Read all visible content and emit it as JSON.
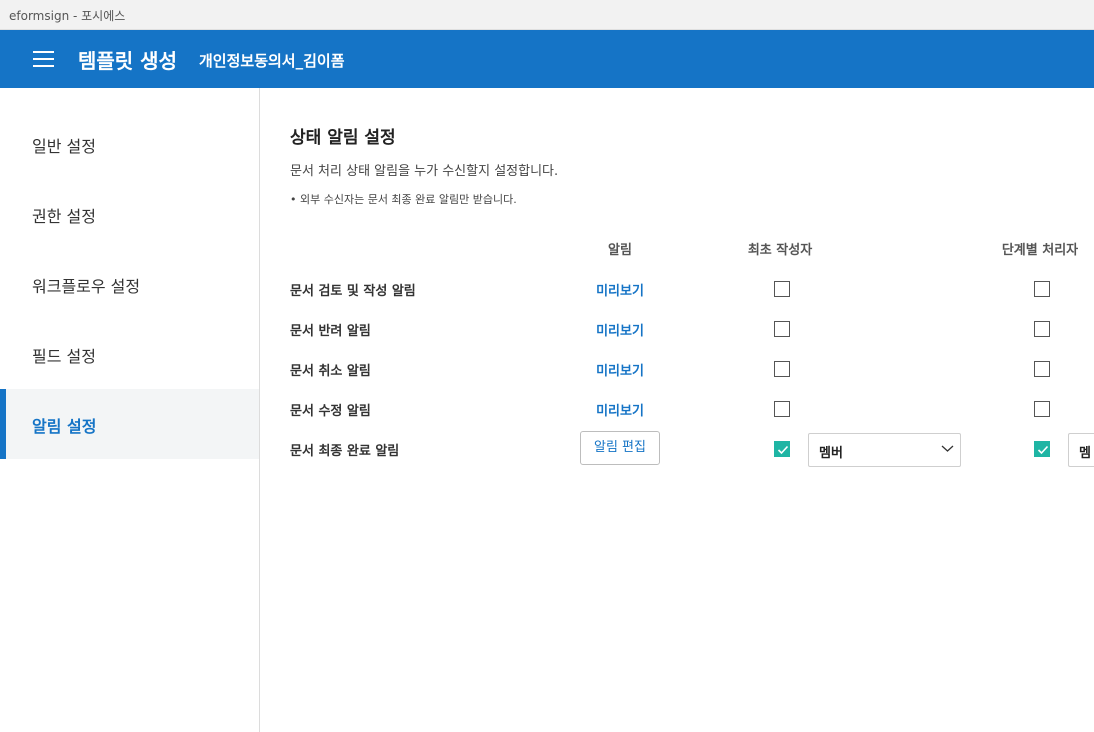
{
  "window": {
    "title": "eformsign - 포시에스"
  },
  "header": {
    "app_title": "템플릿 생성",
    "document_name": "개인정보동의서_김이폼"
  },
  "sidebar": {
    "items": [
      {
        "label": "일반 설정",
        "active": false
      },
      {
        "label": "권한 설정",
        "active": false
      },
      {
        "label": "워크플로우 설정",
        "active": false
      },
      {
        "label": "필드 설정",
        "active": false
      },
      {
        "label": "알림 설정",
        "active": true
      }
    ]
  },
  "main": {
    "title": "상태 알림 설정",
    "description": "문서 처리 상태 알림을 누가 수신할지 설정합니다.",
    "note": "• 외부 수신자는 문서 최종 완료 알림만 받습니다.",
    "columns": {
      "notification": "알림",
      "initial_author": "최초 작성자",
      "step_processor": "단계별 처리자"
    },
    "rows": [
      {
        "label": "문서 검토 및 작성 알림",
        "action": "미리보기",
        "author_checked": false,
        "processor_checked": false
      },
      {
        "label": "문서 반려 알림",
        "action": "미리보기",
        "author_checked": false,
        "processor_checked": false
      },
      {
        "label": "문서 취소 알림",
        "action": "미리보기",
        "author_checked": false,
        "processor_checked": false
      },
      {
        "label": "문서 수정 알림",
        "action": "미리보기",
        "author_checked": false,
        "processor_checked": false
      },
      {
        "label": "문서 최종 완료 알림",
        "action": "알림 편집",
        "author_checked": true,
        "processor_checked": true,
        "author_select": "멤버",
        "processor_select": "멤"
      }
    ]
  },
  "colors": {
    "brand": "#1574c6",
    "checkbox_checked": "#1fb5a4"
  }
}
